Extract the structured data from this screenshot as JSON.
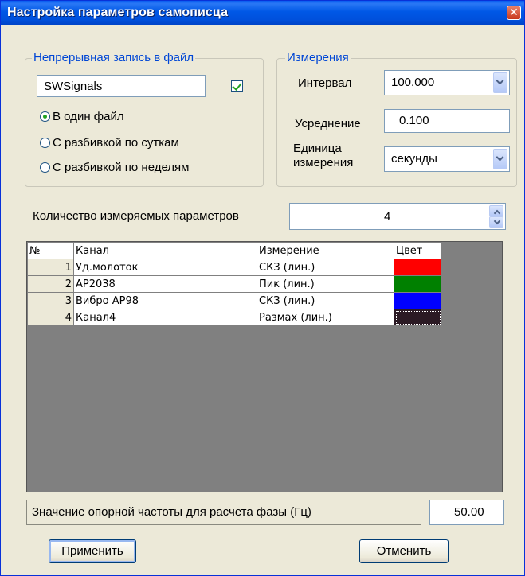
{
  "window": {
    "title": "Настройка параметров самописца",
    "close_glyph": "✕"
  },
  "file_group": {
    "legend": "Непрерывная запись в файл",
    "filename": "SWSignals",
    "enabled": true,
    "radios": [
      {
        "label": "В один файл",
        "selected": true
      },
      {
        "label": "С разбивкой по суткам",
        "selected": false
      },
      {
        "label": "С разбивкой по неделям",
        "selected": false
      }
    ]
  },
  "measure_group": {
    "legend": "Измерения",
    "interval_label": "Интервал",
    "interval_value": "100.000",
    "averaging_label": "Усреднение",
    "averaging_value": "0.100",
    "unit_label_line1": "Единица",
    "unit_label_line2": "измерения",
    "unit_value": "секунды"
  },
  "param_count": {
    "label": "Количество измеряемых параметров",
    "value": "4"
  },
  "grid": {
    "headers": {
      "num": "№",
      "channel": "Канал",
      "measure": "Измерение",
      "color": "Цвет"
    },
    "rows": [
      {
        "num": "1",
        "channel": "Уд.молоток",
        "measure": "СКЗ (лин.)",
        "color": "#ff0000"
      },
      {
        "num": "2",
        "channel": "AP2038",
        "measure": "Пик (лин.)",
        "color": "#008000"
      },
      {
        "num": "3",
        "channel": "Вибро AP98",
        "measure": "СКЗ (лин.)",
        "color": "#0000ff"
      },
      {
        "num": "4",
        "channel": "Канал4",
        "measure": "Размах (лин.)",
        "color": "#2b1a24"
      }
    ]
  },
  "ref_freq": {
    "label": "Значение опорной частоты для расчета фазы (Гц)",
    "value": "50.00"
  },
  "buttons": {
    "apply": "Применить",
    "cancel": "Отменить"
  },
  "icons": {
    "checkbox": "check-icon",
    "combo_arrow": "chevron-down-icon",
    "spin": "spin-arrows-icon",
    "close": "close-icon"
  }
}
